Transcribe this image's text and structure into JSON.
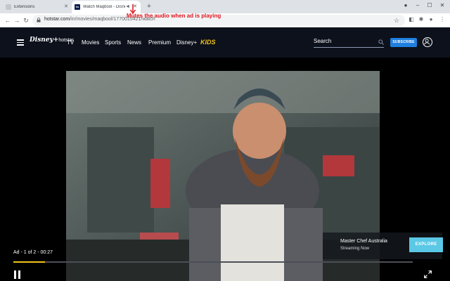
{
  "browser": {
    "tabs": [
      {
        "title": "Extensions",
        "active": false
      },
      {
        "title": "Watch Maqbool - Disney+ H",
        "active": true
      }
    ],
    "url_host": "hotstar.com",
    "url_path": "/in/movies/maqbool/1770015421/watch",
    "icons": [
      "back-icon",
      "forward-icon",
      "reload-icon",
      "lock-icon",
      "star-icon",
      "extension-icon",
      "profile-icon",
      "menu-icon"
    ]
  },
  "annotation": {
    "text": "Mutes the audio when ad is playing",
    "color": "#e0141e"
  },
  "header": {
    "logo_main": "Disney+",
    "logo_sub": "hotstar",
    "nav": [
      "TV",
      "Movies",
      "Sports",
      "News",
      "Premium",
      "Disney+",
      "KIDS"
    ],
    "search_placeholder": "Search",
    "subscribe_label": "SUBSCRIBE",
    "accent": "#1f80e0",
    "kids_color": "#f2c31c"
  },
  "player": {
    "ad_label": "Ad - 1 of 2 - 00:27",
    "progress_fraction": 0.08,
    "progress_color": "#f2c31c",
    "promo_title": "Master Chef Australia",
    "promo_subtitle": "Streaming Now",
    "explore_label": "EXPLORE",
    "explore_color": "#5bc8e6"
  }
}
